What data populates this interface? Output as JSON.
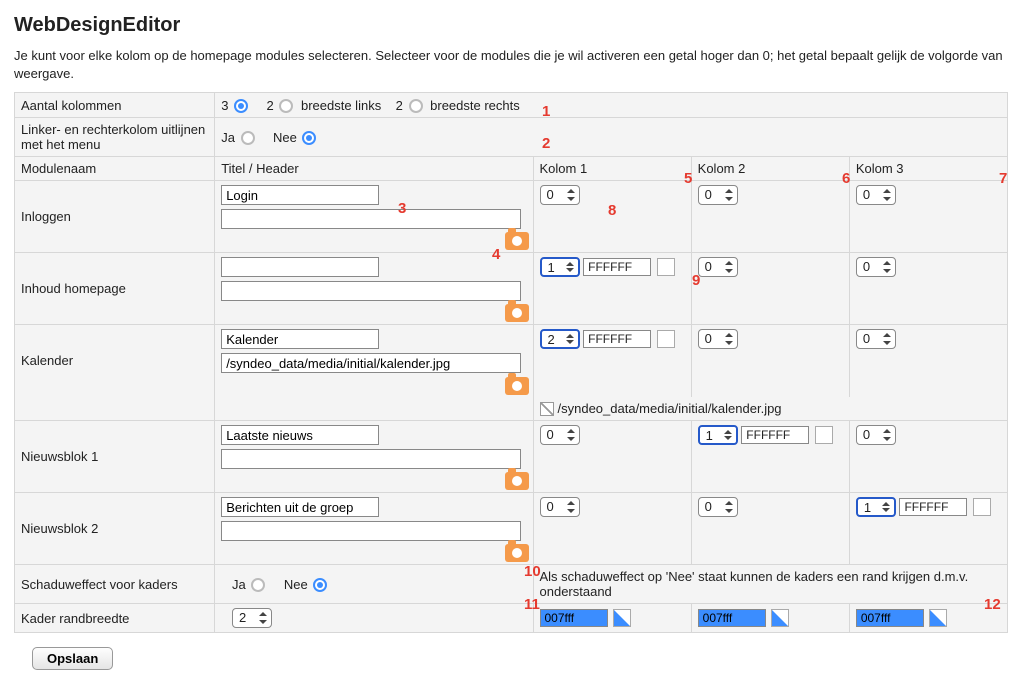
{
  "page": {
    "title": "WebDesignEditor",
    "intro": "Je kunt voor elke kolom op de homepage modules selecteren. Selecteer voor de modules die je wil activeren een getal hoger dan 0; het getal bepaalt gelijk de volgorde van weergave."
  },
  "rows": {
    "aantal": {
      "label": "Aantal kolommen",
      "opt1_num": "3",
      "opt2_num": "2",
      "opt2_label": "breedste links",
      "opt3_num": "2",
      "opt3_label": "breedste rechts"
    },
    "uitlijnen": {
      "label": "Linker- en rechterkolom uitlijnen met het menu",
      "ja": "Ja",
      "nee": "Nee"
    },
    "header": {
      "modulenaam": "Modulenaam",
      "titel": "Titel / Header",
      "k1": "Kolom 1",
      "k2": "Kolom 2",
      "k3": "Kolom 3"
    },
    "schaduw": {
      "label": "Schaduweffect voor kaders",
      "ja": "Ja",
      "nee": "Nee",
      "note": "Als schaduweffect op 'Nee' staat kunnen de kaders een rand krijgen d.m.v. onderstaand"
    },
    "rand": {
      "label": "Kader randbreedte",
      "val": "2",
      "c1": "007fff",
      "c2": "007fff",
      "c3": "007fff"
    }
  },
  "modules": [
    {
      "name": "Inloggen",
      "titel": "Login",
      "path": "",
      "k1": {
        "order": "0",
        "color": null
      },
      "k2": {
        "order": "0",
        "color": null
      },
      "k3": {
        "order": "0",
        "color": null
      },
      "imgtext": ""
    },
    {
      "name": "Inhoud homepage",
      "titel": "",
      "path": "",
      "k1": {
        "order": "1",
        "color": "FFFFFF"
      },
      "k2": {
        "order": "0",
        "color": null
      },
      "k3": {
        "order": "0",
        "color": null
      },
      "imgtext": ""
    },
    {
      "name": "Kalender",
      "titel": "Kalender",
      "path": "/syndeo_data/media/initial/kalender.jpg",
      "k1": {
        "order": "2",
        "color": "FFFFFF"
      },
      "k2": {
        "order": "0",
        "color": null
      },
      "k3": {
        "order": "0",
        "color": null
      },
      "imgtext": "/syndeo_data/media/initial/kalender.jpg"
    },
    {
      "name": "Nieuwsblok 1",
      "titel": "Laatste nieuws",
      "path": "",
      "k1": {
        "order": "0",
        "color": null
      },
      "k2": {
        "order": "1",
        "color": "FFFFFF"
      },
      "k3": {
        "order": "0",
        "color": null
      },
      "imgtext": ""
    },
    {
      "name": "Nieuwsblok 2",
      "titel": "Berichten uit de groep",
      "path": "",
      "k1": {
        "order": "0",
        "color": null
      },
      "k2": {
        "order": "0",
        "color": null
      },
      "k3": {
        "order": "1",
        "color": "FFFFFF"
      },
      "imgtext": ""
    }
  ],
  "buttons": {
    "save": "Opslaan"
  },
  "annotations": [
    "1",
    "2",
    "3",
    "4",
    "5",
    "6",
    "7",
    "8",
    "9",
    "10",
    "11",
    "12"
  ]
}
